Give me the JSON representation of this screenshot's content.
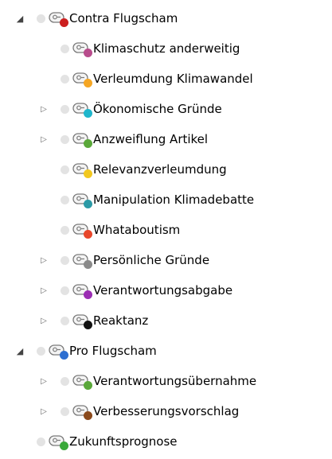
{
  "tree": [
    {
      "level": 0,
      "toggle": "expanded",
      "label": "Contra Flugscham",
      "color": "#cc1f1f"
    },
    {
      "level": 1,
      "toggle": "none",
      "label": "Klimaschutz anderweitig",
      "color": "#b84c8c"
    },
    {
      "level": 1,
      "toggle": "none",
      "label": "Verleumdung Klimawandel",
      "color": "#f5a623"
    },
    {
      "level": 1,
      "toggle": "collapsed",
      "label": "Ökonomische Gründe",
      "color": "#1fb6cc"
    },
    {
      "level": 1,
      "toggle": "collapsed",
      "label": "Anzweiflung Artikel",
      "color": "#5aa83a"
    },
    {
      "level": 1,
      "toggle": "none",
      "label": "Relevanzverleumdung",
      "color": "#f2c81f"
    },
    {
      "level": 1,
      "toggle": "none",
      "label": "Manipulation Klimadebatte",
      "color": "#2b9aa6"
    },
    {
      "level": 1,
      "toggle": "none",
      "label": "Whataboutism",
      "color": "#e8472b"
    },
    {
      "level": 1,
      "toggle": "collapsed",
      "label": "Persönliche Gründe",
      "color": "#8a8a8a"
    },
    {
      "level": 1,
      "toggle": "collapsed",
      "label": "Verantwortungsabgabe",
      "color": "#9b2db3"
    },
    {
      "level": 1,
      "toggle": "collapsed",
      "label": "Reaktanz",
      "color": "#111111"
    },
    {
      "level": 0,
      "toggle": "expanded",
      "label": "Pro Flugscham",
      "color": "#2d6fd1"
    },
    {
      "level": 1,
      "toggle": "collapsed",
      "label": "Verantwortungsübernahme",
      "color": "#5aa83a"
    },
    {
      "level": 1,
      "toggle": "collapsed",
      "label": "Verbesserungsvorschlag",
      "color": "#8b4a1c"
    },
    {
      "level": 0,
      "toggle": "none",
      "label": "Zukunftsprognose",
      "color": "#3aa83a"
    }
  ],
  "icons": {
    "expanded": "▲",
    "collapsed": "▷",
    "code": "code-icon",
    "dot": "status-dot-icon"
  }
}
